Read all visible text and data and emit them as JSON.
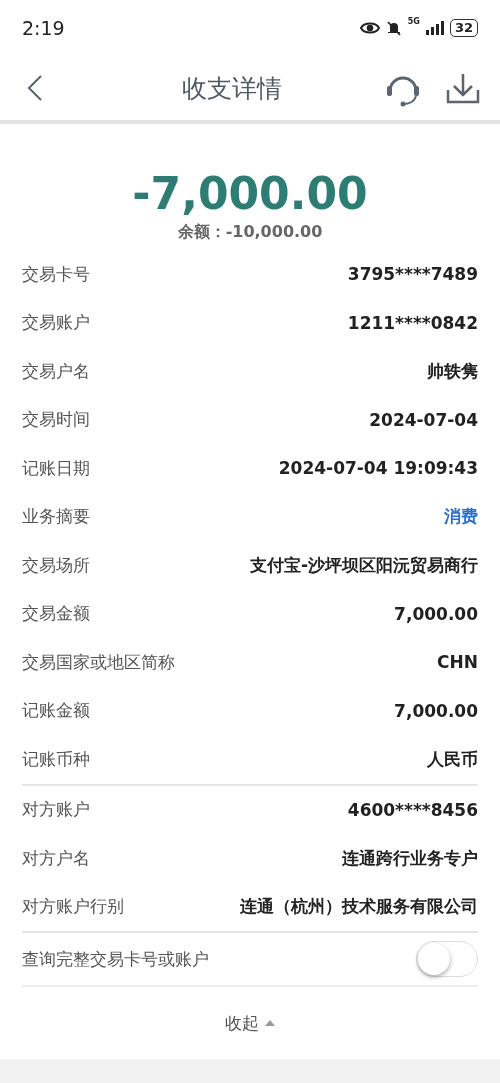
{
  "status_bar": {
    "time": "2:19",
    "network": "5G",
    "battery": "32"
  },
  "header": {
    "title": "收支详情"
  },
  "summary": {
    "amount": "-7,000.00",
    "balance": "余额：-10,000.00"
  },
  "sections": [
    {
      "rows": [
        {
          "label": "交易卡号",
          "value": "3795****7489",
          "kind": "text"
        },
        {
          "label": "交易账户",
          "value": "1211****0842",
          "kind": "text"
        },
        {
          "label": "交易户名",
          "value": "帅轶隽",
          "kind": "text"
        },
        {
          "label": "交易时间",
          "value": "2024-07-04",
          "kind": "text"
        },
        {
          "label": "记账日期",
          "value": "2024-07-04 19:09:43",
          "kind": "text"
        },
        {
          "label": "业务摘要",
          "value": "消费",
          "kind": "link"
        },
        {
          "label": "交易场所",
          "value": "支付宝-沙坪坝区阳沅贸易商行",
          "kind": "text"
        },
        {
          "label": "交易金额",
          "value": "7,000.00",
          "kind": "text"
        },
        {
          "label": "交易国家或地区简称",
          "value": "CHN",
          "kind": "text"
        },
        {
          "label": "记账金额",
          "value": "7,000.00",
          "kind": "text"
        },
        {
          "label": "记账币种",
          "value": "人民币",
          "kind": "text"
        }
      ]
    },
    {
      "rows": [
        {
          "label": "对方账户",
          "value": "4600****8456",
          "kind": "text"
        },
        {
          "label": "对方户名",
          "value": "连通跨行业务专户",
          "kind": "text"
        },
        {
          "label": "对方账户行别",
          "value": "连通（杭州）技术服务有限公司",
          "kind": "text"
        }
      ]
    }
  ],
  "full_number_toggle": {
    "label": "查询完整交易卡号或账户",
    "on": false
  },
  "collapse": {
    "label": "收起"
  }
}
